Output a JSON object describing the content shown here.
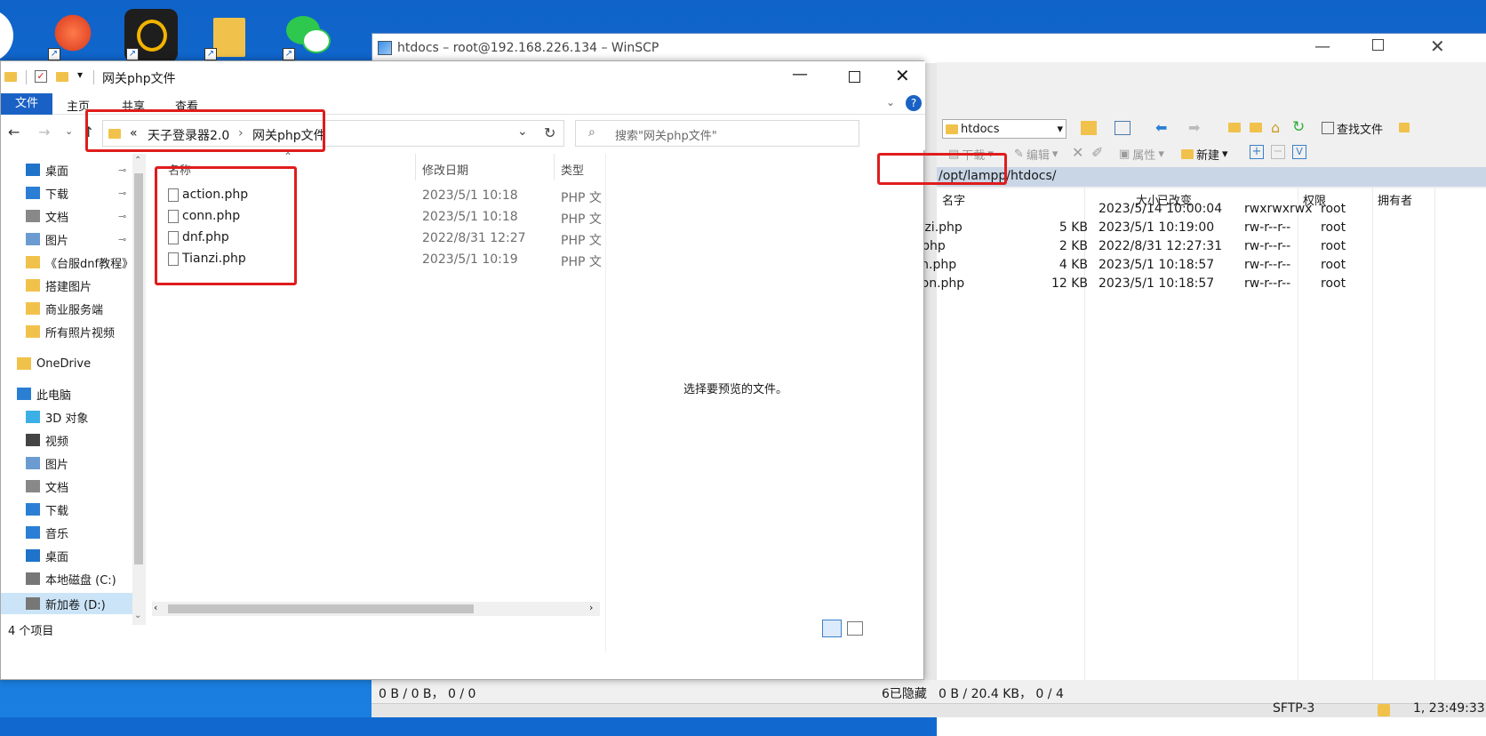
{
  "colors": {
    "accent": "#1660c4",
    "highlight_box": "#e01c1c",
    "desktop_bg": "#1169d0"
  },
  "winscp": {
    "title": "htdocs – root@192.168.226.134 – WinSCP",
    "remote_dir_selector": "htdocs",
    "toolbar": {
      "find_files": "查找文件",
      "download": "下载",
      "edit": "编辑",
      "properties": "属性",
      "new": "新建"
    },
    "path": "/opt/lampp/htdocs/",
    "columns": [
      "名字",
      "大小",
      "已改变",
      "权限",
      "拥有者"
    ],
    "rows": [
      {
        "name": "..",
        "size": "",
        "modified": "2023/5/14 10:00:04",
        "perm": "rwxrwxrwx",
        "owner": "root"
      },
      {
        "name": "Tianzi.php",
        "size": "5 KB",
        "modified": "2023/5/1 10:19:00",
        "perm": "rw-r--r--",
        "owner": "root"
      },
      {
        "name": "dnf.php",
        "size": "2 KB",
        "modified": "2022/8/31 12:27:31",
        "perm": "rw-r--r--",
        "owner": "root"
      },
      {
        "name": "conn.php",
        "size": "4 KB",
        "modified": "2023/5/1 10:18:57",
        "perm": "rw-r--r--",
        "owner": "root"
      },
      {
        "name": "action.php",
        "size": "12 KB",
        "modified": "2023/5/1 10:18:57",
        "perm": "rw-r--r--",
        "owner": "root"
      }
    ],
    "status_left": "0 B / 0 B， 0 / 0",
    "status_hidden": "6已隐藏",
    "status_right": "0 B / 20.4 KB， 0 / 4",
    "protocol": "SFTP-3",
    "time": "1, 23:49:33"
  },
  "explorer": {
    "title": "网关php文件",
    "ribbon_tabs": [
      "文件",
      "主页",
      "共享",
      "查看"
    ],
    "breadcrumb": [
      "«",
      "天子登录器2.0",
      "›",
      "网关php文件"
    ],
    "search_placeholder": "搜索\"网关php文件\"",
    "columns": {
      "name": "名称",
      "modified": "修改日期",
      "type": "类型"
    },
    "files": [
      {
        "name": "action.php",
        "modified": "2023/5/1 10:18",
        "type": "PHP 文"
      },
      {
        "name": "conn.php",
        "modified": "2023/5/1 10:18",
        "type": "PHP 文"
      },
      {
        "name": "dnf.php",
        "modified": "2022/8/31 12:27",
        "type": "PHP 文"
      },
      {
        "name": "Tianzi.php",
        "modified": "2023/5/1 10:19",
        "type": "PHP 文"
      }
    ],
    "preview_text": "选择要预览的文件。",
    "status": "4 个项目",
    "nav": [
      {
        "label": "桌面",
        "icon": "desktop-icon",
        "pinned": true
      },
      {
        "label": "下载",
        "icon": "download-icon",
        "pinned": true
      },
      {
        "label": "文档",
        "icon": "document-icon",
        "pinned": true
      },
      {
        "label": "图片",
        "icon": "picture-icon",
        "pinned": true
      },
      {
        "label": "《台服dnf教程》",
        "icon": "folder-icon",
        "pinned": false
      },
      {
        "label": "搭建图片",
        "icon": "folder-icon",
        "pinned": false
      },
      {
        "label": "商业服务端",
        "icon": "folder-icon",
        "pinned": false
      },
      {
        "label": "所有照片视频",
        "icon": "folder-icon",
        "pinned": false
      },
      {
        "label": "OneDrive",
        "icon": "onedrive-icon",
        "pinned": false
      },
      {
        "label": "此电脑",
        "icon": "computer-icon",
        "pinned": false
      },
      {
        "label": "3D 对象",
        "icon": "3d-objects-icon",
        "pinned": false
      },
      {
        "label": "视频",
        "icon": "video-icon",
        "pinned": false
      },
      {
        "label": "图片",
        "icon": "picture-icon",
        "pinned": false
      },
      {
        "label": "文档",
        "icon": "document-icon",
        "pinned": false
      },
      {
        "label": "下载",
        "icon": "download-icon",
        "pinned": false
      },
      {
        "label": "音乐",
        "icon": "music-icon",
        "pinned": false
      },
      {
        "label": "桌面",
        "icon": "desktop-icon",
        "pinned": false
      },
      {
        "label": "本地磁盘 (C:)",
        "icon": "drive-icon",
        "pinned": false
      },
      {
        "label": "新加卷 (D:)",
        "icon": "drive-icon",
        "pinned": false
      }
    ]
  }
}
